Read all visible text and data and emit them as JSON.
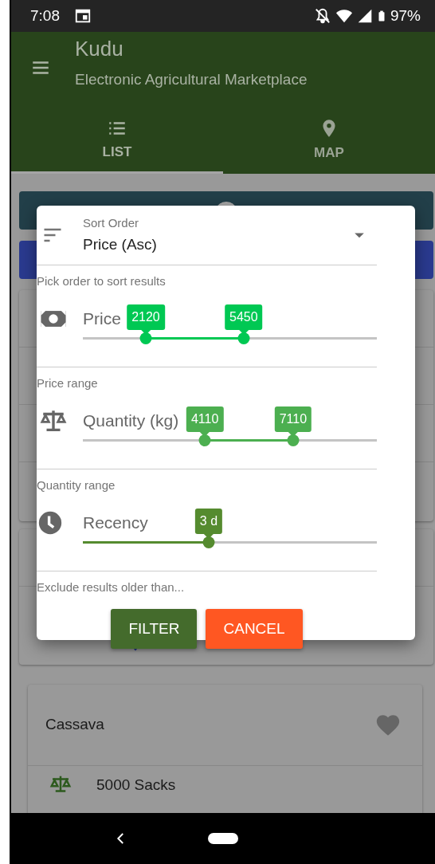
{
  "status_bar": {
    "time": "7:08",
    "battery": "97%"
  },
  "app_bar": {
    "title": "Kudu",
    "subtitle": "Electronic Agricultural Marketplace"
  },
  "tabs": [
    {
      "label": "LIST",
      "selected": true
    },
    {
      "label": "MAP",
      "selected": false
    }
  ],
  "dialog": {
    "sort": {
      "label": "Sort Order",
      "value": "Price (Asc)",
      "helper": "Pick order to sort results"
    },
    "sliders": [
      {
        "label": "Price",
        "color": "#00c853",
        "thumbs": [
          {
            "label": "2120",
            "level": 0.214
          },
          {
            "label": "5450",
            "level": 0.547
          }
        ],
        "helper": "Price range"
      },
      {
        "label": "Quantity (kg)",
        "color": "#4caf50",
        "thumbs": [
          {
            "label": "4110",
            "level": 0.415
          },
          {
            "label": "7110",
            "level": 0.715
          }
        ],
        "helper": "Quantity range"
      },
      {
        "label": "Recency",
        "color": "#558b2f",
        "thumbs": [
          {
            "label": "3 d",
            "level": 0.428
          }
        ],
        "helper": "Exclude results older than..."
      }
    ],
    "buttons": [
      {
        "label": "FILTER",
        "kind": "primary"
      },
      {
        "label": "CANCEL",
        "kind": "cancel"
      }
    ]
  },
  "listing": {
    "title": "Cassava",
    "quantity": "5000 Sacks"
  }
}
